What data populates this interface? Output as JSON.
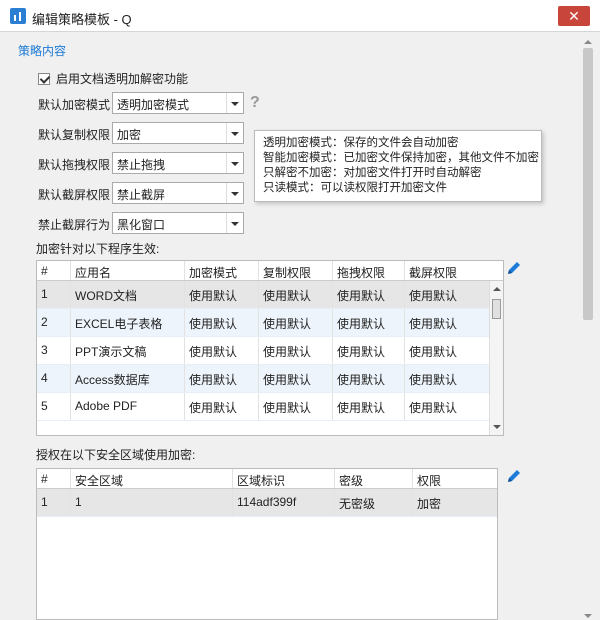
{
  "window": {
    "title": "编辑策略模板 - Q",
    "close_glyph": "✕"
  },
  "section": {
    "title": "策略内容"
  },
  "transparent_checkbox": {
    "label": "启用文档透明加解密功能",
    "checked": true
  },
  "fields": [
    {
      "label": "默认加密模式",
      "value": "透明加密模式"
    },
    {
      "label": "默认复制权限",
      "value": "加密"
    },
    {
      "label": "默认拖拽权限",
      "value": "禁止拖拽"
    },
    {
      "label": "默认截屏权限",
      "value": "禁止截屏"
    },
    {
      "label": "禁止截屏行为",
      "value": "黑化窗口"
    }
  ],
  "help_glyph": "?",
  "tooltip": {
    "lines": [
      "透明加密模式：保存的文件会自动加密",
      "智能加密模式：已加密文件保持加密，其他文件不加密",
      "只解密不加密：对加密文件打开时自动解密",
      "只读模式：可以读权限打开加密文件"
    ]
  },
  "program_table": {
    "title": "加密针对以下程序生效:",
    "headers": [
      "#",
      "应用名",
      "加密模式",
      "复制权限",
      "拖拽权限",
      "截屏权限"
    ],
    "rows": [
      [
        "1",
        "WORD文档",
        "使用默认",
        "使用默认",
        "使用默认",
        "使用默认"
      ],
      [
        "2",
        "EXCEL电子表格",
        "使用默认",
        "使用默认",
        "使用默认",
        "使用默认"
      ],
      [
        "3",
        "PPT演示文稿",
        "使用默认",
        "使用默认",
        "使用默认",
        "使用默认"
      ],
      [
        "4",
        "Access数据库",
        "使用默认",
        "使用默认",
        "使用默认",
        "使用默认"
      ],
      [
        "5",
        "Adobe PDF",
        "使用默认",
        "使用默认",
        "使用默认",
        "使用默认"
      ]
    ]
  },
  "zone_table": {
    "title": "授权在以下安全区域使用加密:",
    "headers": [
      "#",
      "安全区域",
      "区域标识",
      "密级",
      "权限"
    ],
    "rows": [
      [
        "1",
        "1",
        "114adf399f",
        "无密级",
        "加密"
      ]
    ]
  },
  "colors": {
    "accent": "#1c7ad8",
    "close": "#c8453b",
    "selected_row": "#e6e6e6",
    "alt_row": "#eef4fb"
  }
}
